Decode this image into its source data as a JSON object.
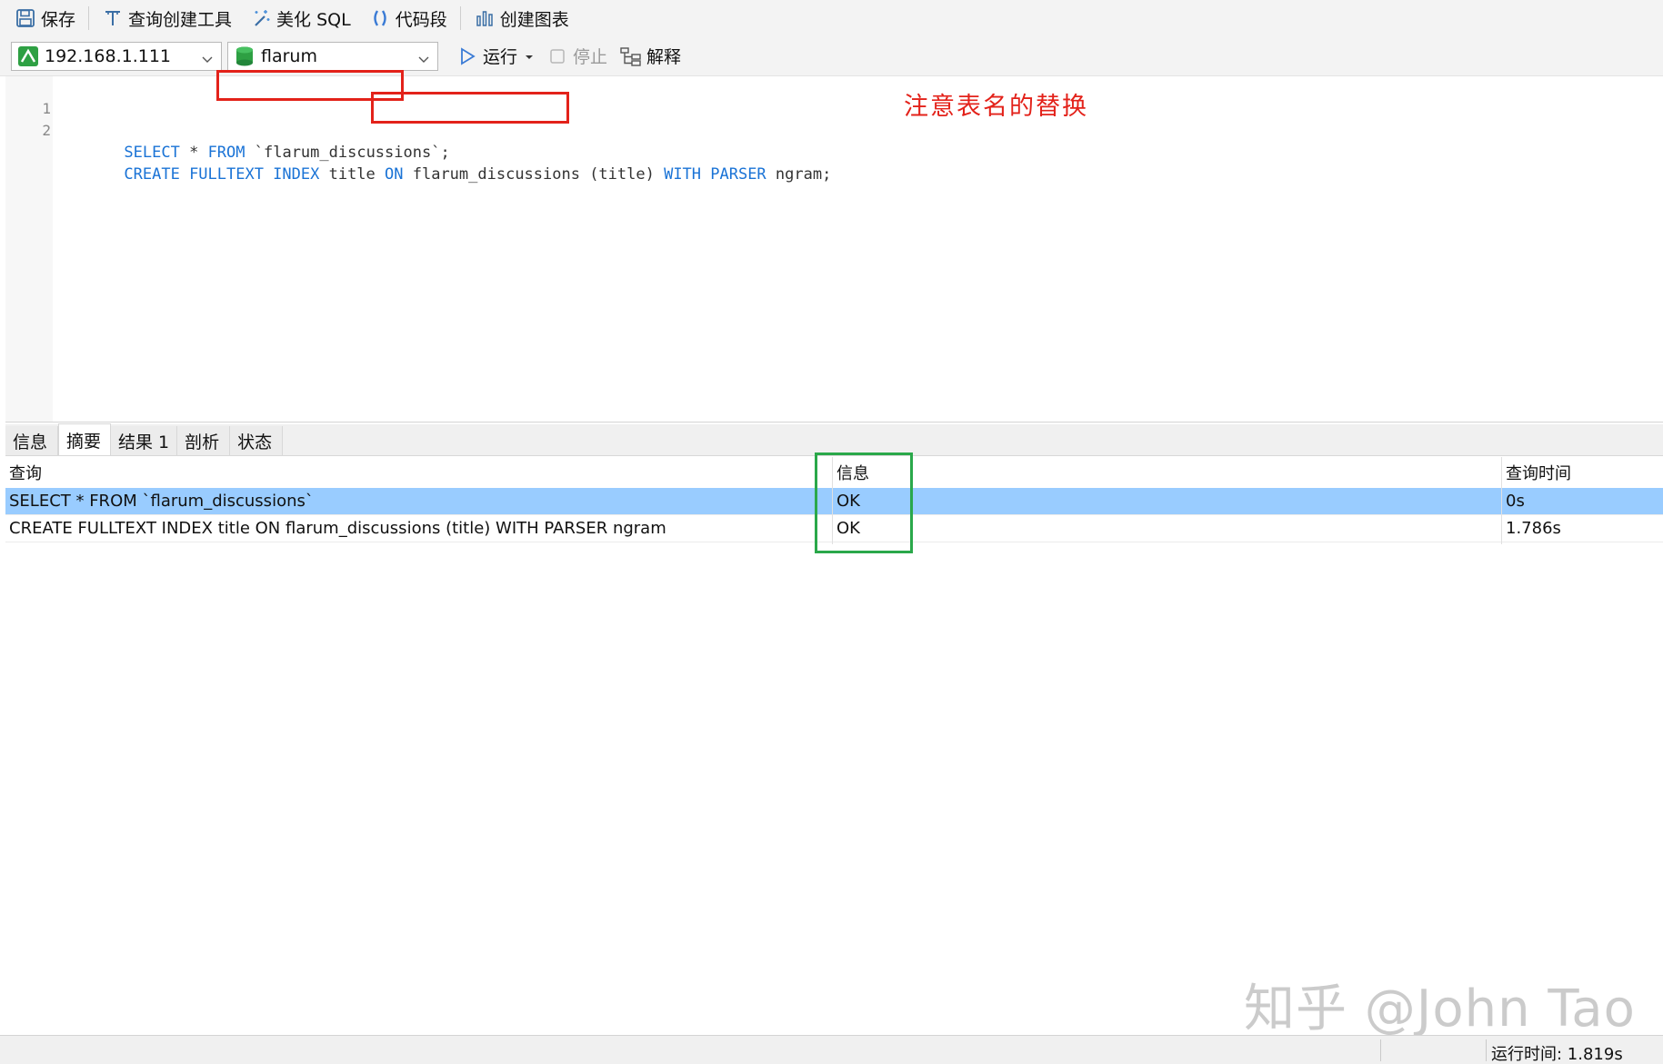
{
  "toolbar": {
    "save_label": "保存",
    "query_builder_label": "查询创建工具",
    "beautify_label": "美化 SQL",
    "snippet_label": "代码段",
    "chart_label": "创建图表"
  },
  "connection": {
    "host": "192.168.1.111",
    "database": "flarum"
  },
  "run_bar": {
    "run_label": "运行",
    "stop_label": "停止",
    "explain_label": "解释"
  },
  "editor": {
    "lines": [
      {
        "number": "1",
        "segments": [
          {
            "text": "SELECT",
            "kind": "kw"
          },
          {
            "text": " * ",
            "kind": "tx"
          },
          {
            "text": "FROM",
            "kind": "kw"
          },
          {
            "text": " `flarum_discussions`;",
            "kind": "tx"
          }
        ]
      },
      {
        "number": "2",
        "segments": [
          {
            "text": "CREATE FULLTEXT INDEX",
            "kind": "kw"
          },
          {
            "text": " title ",
            "kind": "tx"
          },
          {
            "text": "ON",
            "kind": "kw"
          },
          {
            "text": " flarum_discussions (title) ",
            "kind": "tx"
          },
          {
            "text": "WITH PARSER",
            "kind": "kw"
          },
          {
            "text": " ngram;",
            "kind": "tx"
          }
        ]
      }
    ],
    "annotation": "注意表名的替换"
  },
  "tabs": [
    "信息",
    "摘要",
    "结果 1",
    "剖析",
    "状态"
  ],
  "active_tab_index": 1,
  "results": {
    "columns": [
      "查询",
      "信息",
      "查询时间"
    ],
    "rows": [
      [
        "SELECT * FROM `flarum_discussions`",
        "OK",
        "0s"
      ],
      [
        "CREATE FULLTEXT INDEX title ON flarum_discussions (title) WITH PARSER ngram",
        "OK",
        "1.786s"
      ]
    ],
    "selected_row_index": 0
  },
  "status": {
    "run_time": "运行时间: 1.819s"
  },
  "watermark": "知乎 @John Tao",
  "colors": {
    "keyword": "#1a73d6",
    "annotation_red": "#e3221a",
    "highlight_green": "#2aa84a",
    "selected_row": "#99ccff"
  }
}
